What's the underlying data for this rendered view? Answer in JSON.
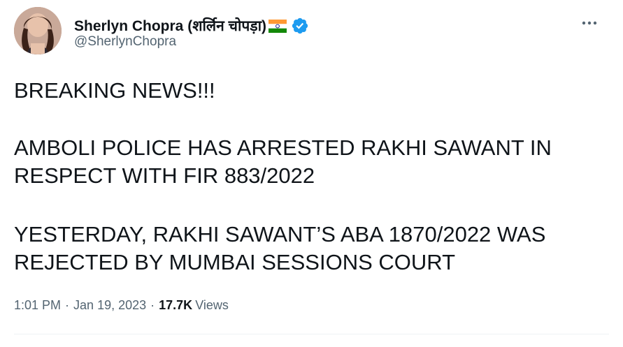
{
  "author": {
    "display_name": "Sherlyn Chopra (शर्लिन चोपड़ा)",
    "handle": "@SherlynChopra"
  },
  "tweet": {
    "lines": [
      "BREAKING NEWS!!!",
      "AMBOLI POLICE HAS ARRESTED RAKHI SAWANT IN",
      "RESPECT WITH FIR 883/2022",
      "YESTERDAY, RAKHI SAWANT’S ABA 1870/2022 WAS",
      "REJECTED BY MUMBAI SESSIONS COURT"
    ]
  },
  "meta": {
    "time": "1:01 PM",
    "separator": "·",
    "date": "Jan 19, 2023",
    "views_count": "17.7K",
    "views_label": "Views"
  },
  "colors": {
    "text": "#0f1419",
    "secondary": "#536471",
    "verified": "#1d9bf0",
    "divider": "#eff3f4"
  },
  "icons": {
    "verified": "verified-badge-icon",
    "more": "more-options-icon",
    "flag": "india-flag-icon"
  }
}
